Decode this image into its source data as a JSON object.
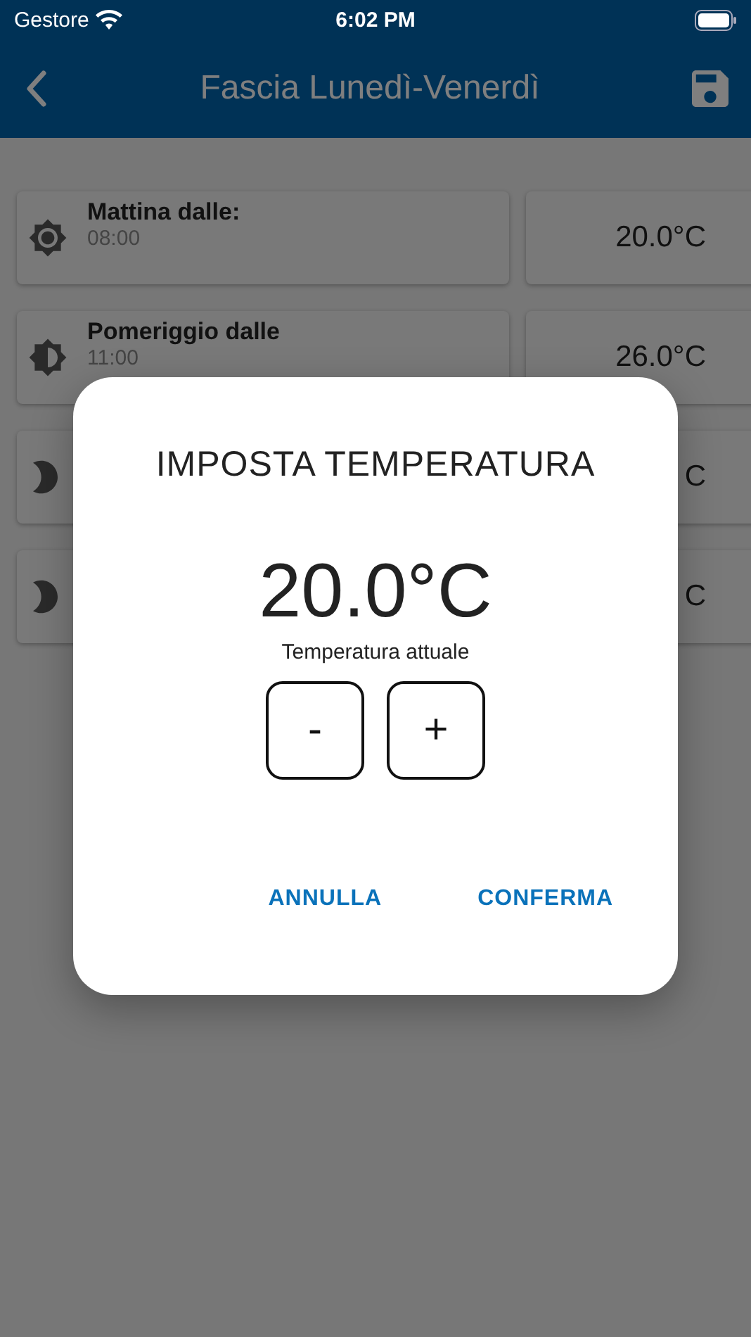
{
  "status_bar": {
    "carrier": "Gestore",
    "time": "6:02 PM"
  },
  "header": {
    "title": "Fascia Lunedì-Venerdì"
  },
  "slots": [
    {
      "kind": "sun",
      "label": "Mattina dalle:",
      "time": "08:00",
      "value": "20.0°C"
    },
    {
      "kind": "half",
      "label": "Pomeriggio dalle",
      "time": "11:00",
      "value": "26.0°C"
    },
    {
      "kind": "moon",
      "value": "C"
    },
    {
      "kind": "moon",
      "value": "C"
    }
  ],
  "dialog": {
    "title": "IMPOSTA TEMPERATURA",
    "value": "20.0°C",
    "caption": "Temperatura attuale",
    "steppers": [
      "-",
      "+"
    ],
    "actions": [
      "ANNULLA",
      "CONFERMA"
    ]
  }
}
